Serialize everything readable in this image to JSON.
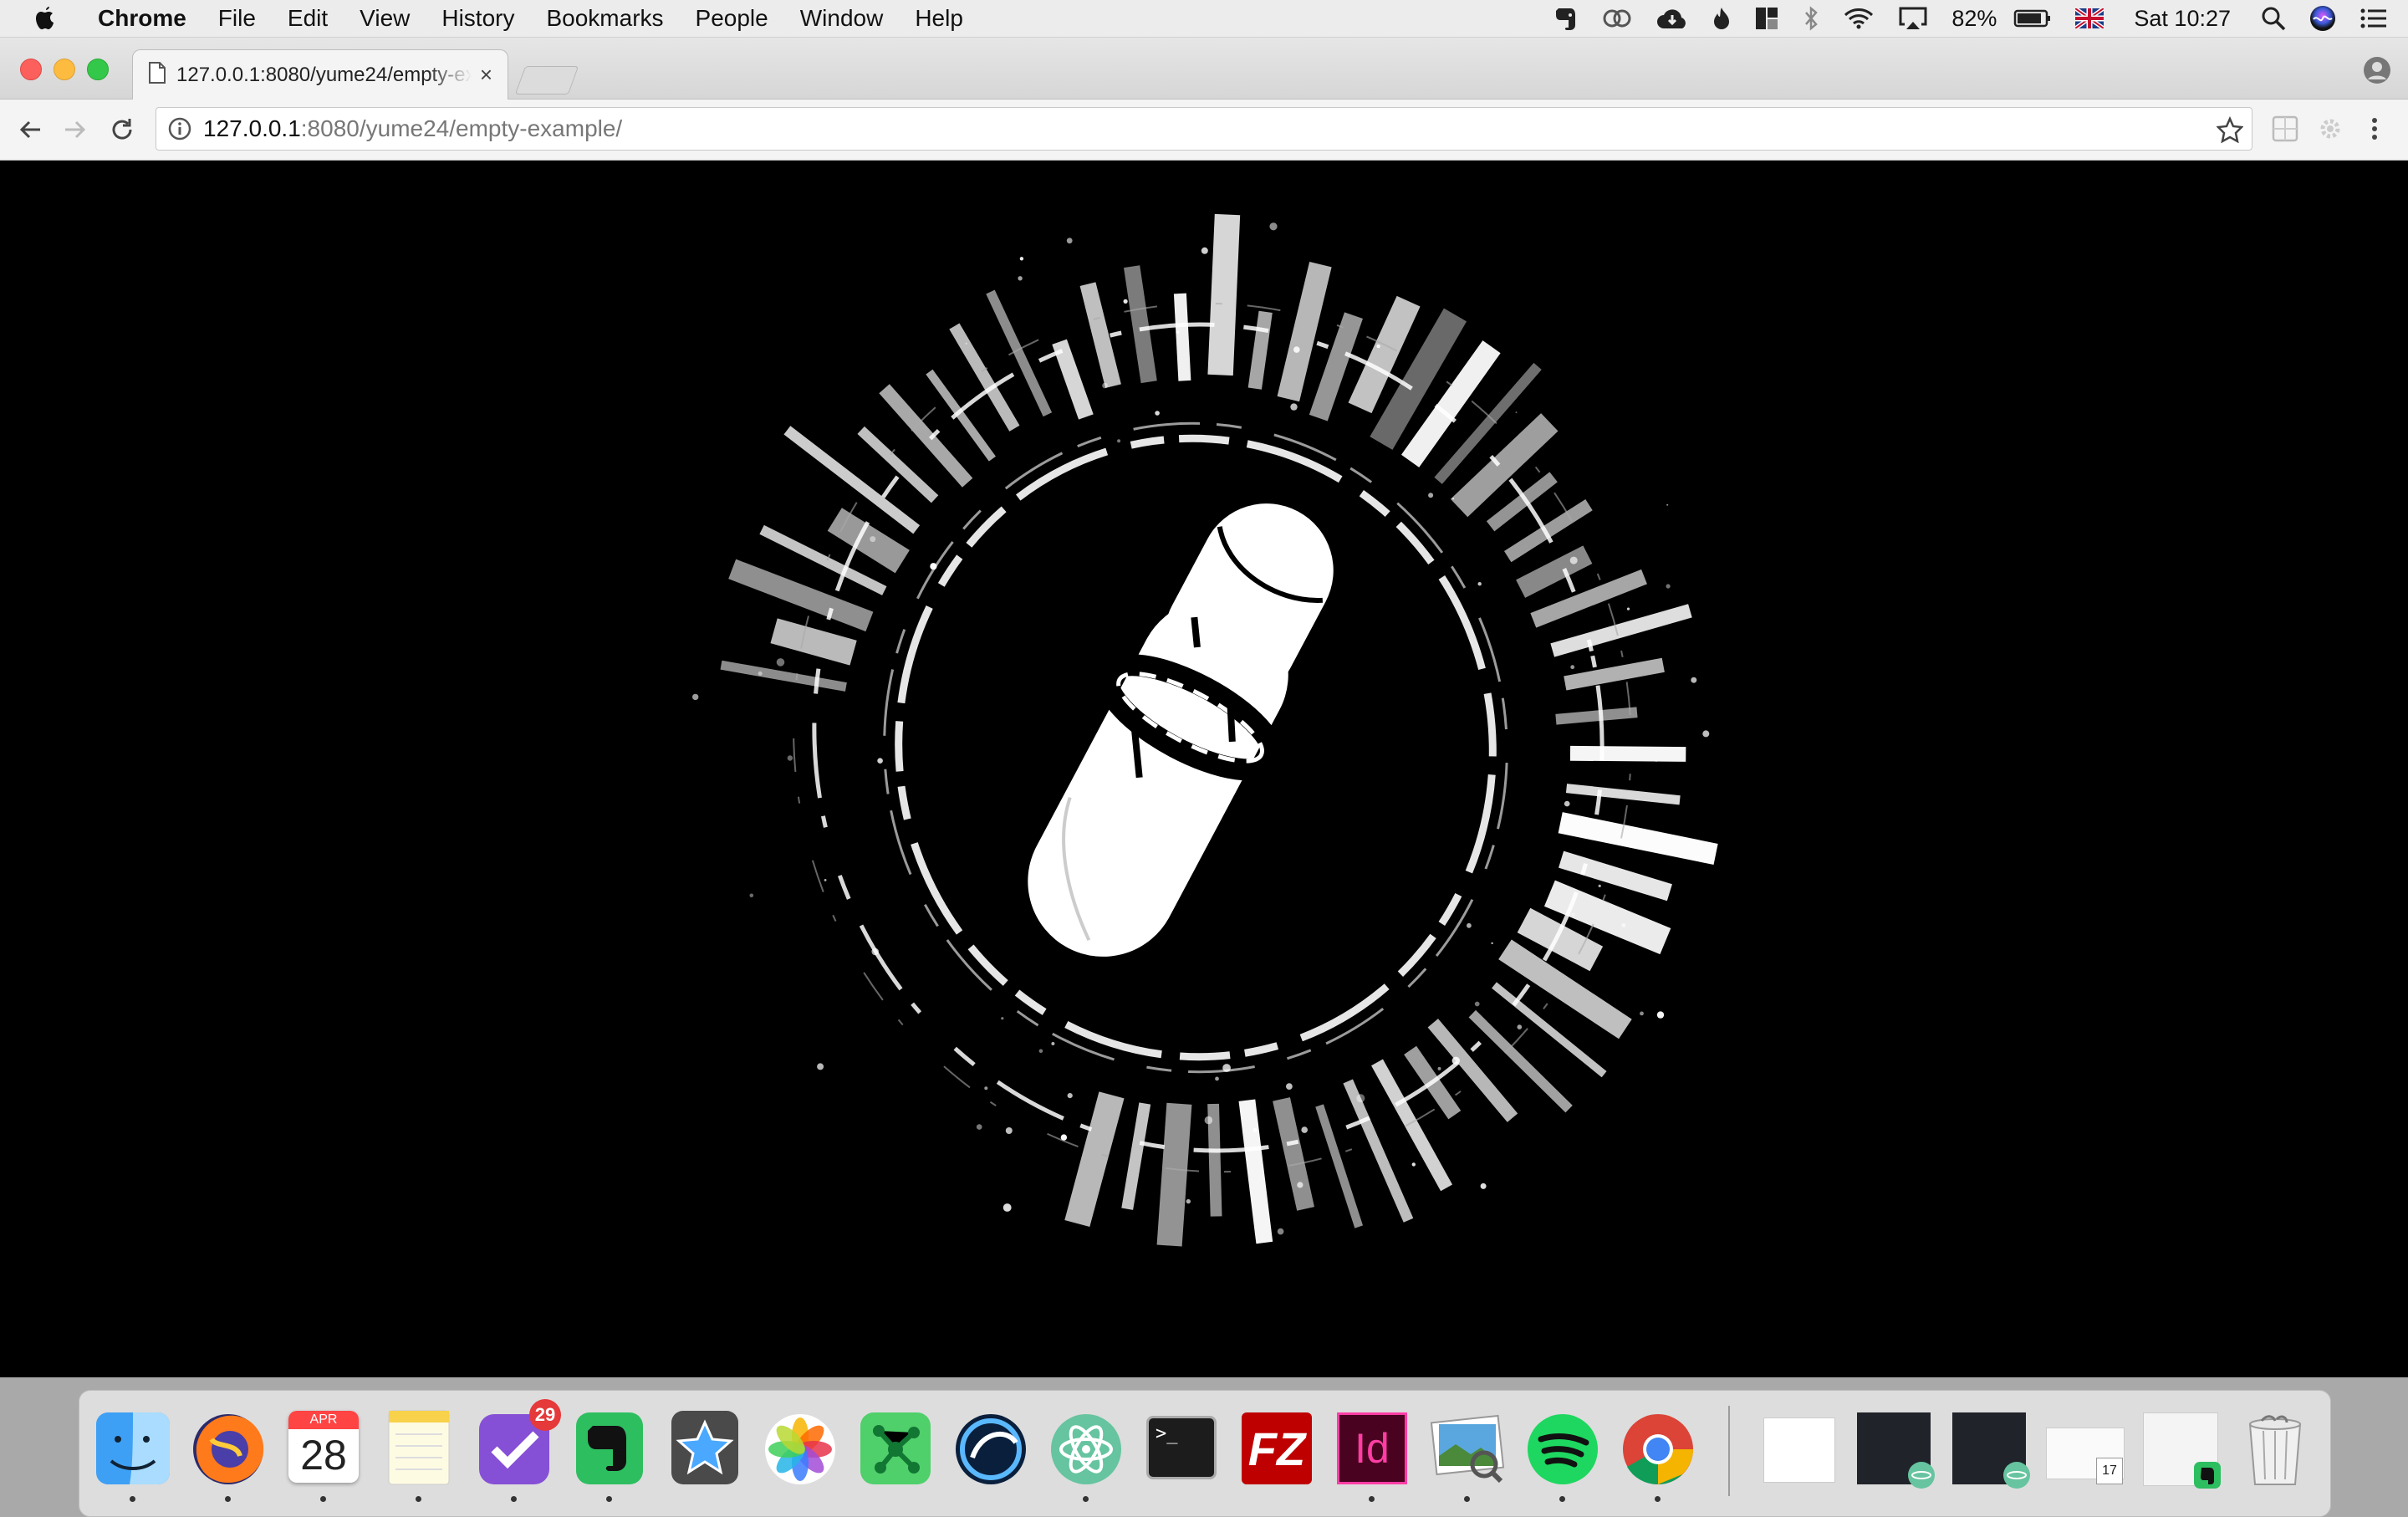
{
  "menubar": {
    "app_name": "Chrome",
    "menus": [
      "File",
      "Edit",
      "View",
      "History",
      "Bookmarks",
      "People",
      "Window",
      "Help"
    ],
    "battery_percent": "82%",
    "clock": "Sat 10:27"
  },
  "browser": {
    "tab_title": "127.0.0.1:8080/yume24/empty-example/",
    "tab_close": "×",
    "url_host": "127.0.0.1",
    "url_path": ":8080/yume24/empty-example/"
  },
  "dock": {
    "calendar_month": "APR",
    "calendar_day": "28",
    "omnifocus_badge": "29",
    "terminal_prompt": ">_",
    "filezilla_label": "FZ",
    "indesign_label": "Id",
    "mini_calendar_day": "17"
  },
  "colors": {
    "close": "#fc605c",
    "minimize": "#fdbc40",
    "zoom": "#34c84a",
    "indesign": "#ff3ea5",
    "filezilla": "#bf0000",
    "spotify": "#1ed760"
  }
}
